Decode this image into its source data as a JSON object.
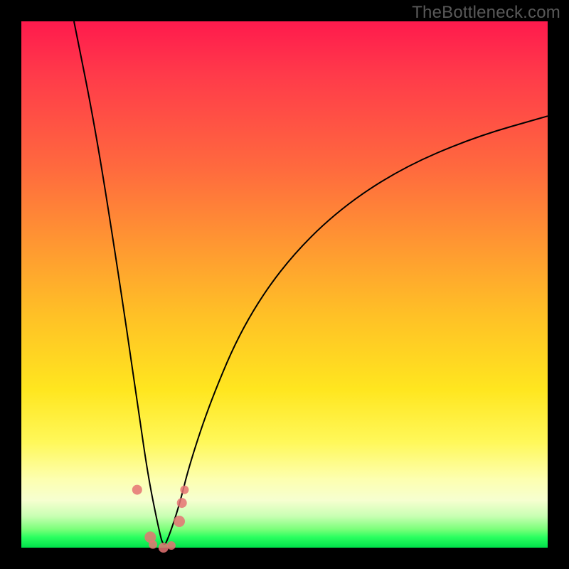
{
  "attribution": "TheBottleneck.com",
  "colors": {
    "page_bg": "#000000",
    "gradient_top": "#ff1a4d",
    "gradient_mid": "#ffe61f",
    "gradient_bottom": "#00e04a",
    "curve": "#000000",
    "markers": "#e57373"
  },
  "chart_data": {
    "type": "line",
    "title": "",
    "xlabel": "",
    "ylabel": "",
    "xlim": [
      0,
      100
    ],
    "ylim": [
      0,
      100
    ],
    "grid": false,
    "legend": false,
    "notes": "V-shaped bottleneck curve. No numeric axis ticks are rendered; x and y normalized 0–100 from pixel positions. Minimum near x≈27, y≈0. Left branch rises steeply to y≈100 at x≈10; right branch rises with decreasing slope toward y≈82 at x≈100.",
    "series": [
      {
        "name": "bottleneck-curve",
        "x": [
          10,
          14,
          18,
          22,
          24,
          26,
          27,
          28,
          30,
          32,
          36,
          42,
          50,
          60,
          72,
          86,
          100
        ],
        "y": [
          100,
          80,
          55,
          28,
          14,
          4,
          0,
          2,
          8,
          16,
          28,
          42,
          54,
          64,
          72,
          78,
          82
        ]
      }
    ],
    "markers": [
      {
        "x": 22.0,
        "y": 11.0,
        "r": 7
      },
      {
        "x": 24.5,
        "y": 2.0,
        "r": 8
      },
      {
        "x": 25.0,
        "y": 0.6,
        "r": 6
      },
      {
        "x": 27.0,
        "y": 0.0,
        "r": 7
      },
      {
        "x": 28.5,
        "y": 0.4,
        "r": 6
      },
      {
        "x": 30.0,
        "y": 5.0,
        "r": 8
      },
      {
        "x": 30.5,
        "y": 8.5,
        "r": 7
      },
      {
        "x": 31.0,
        "y": 11.0,
        "r": 6
      }
    ]
  }
}
